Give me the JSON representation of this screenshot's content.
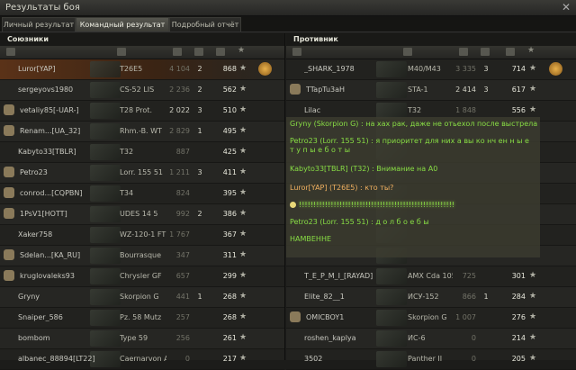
{
  "window": {
    "title": "Результаты боя"
  },
  "tabs": [
    "Личный результат",
    "Командный результат",
    "Подробный отчёт"
  ],
  "allies": {
    "title": "Союзники",
    "rows": [
      {
        "name": "Luror[YAP]",
        "tank": "T26E5",
        "damage": "4 104",
        "kills": "2",
        "xp": "868",
        "medal": true,
        "highlight": true
      },
      {
        "name": "sergeyovs1980",
        "tank": "CS-52 LIS",
        "damage": "2 236",
        "kills": "2",
        "xp": "562"
      },
      {
        "name": "vetaliy85[-UAR-]",
        "tank": "T28 Prot.",
        "damage": "2 022",
        "kills": "3",
        "xp": "510",
        "badge": true,
        "bright": true
      },
      {
        "name": "Renam...[UA_32]",
        "tank": "Rhm.-B. WT",
        "damage": "2 829",
        "kills": "1",
        "xp": "495",
        "badge": true
      },
      {
        "name": "Kabyto33[TBLR]",
        "tank": "T32",
        "damage": "887",
        "kills": "",
        "xp": "425"
      },
      {
        "name": "Petro23",
        "tank": "Lorr. 155 51",
        "damage": "1 211",
        "kills": "3",
        "xp": "411",
        "badge": true
      },
      {
        "name": "conrod...[CQPBN]",
        "tank": "T34",
        "damage": "824",
        "kills": "",
        "xp": "395",
        "badge": true
      },
      {
        "name": "1PsV1[HOTT]",
        "tank": "UDES 14 5",
        "damage": "992",
        "kills": "2",
        "xp": "386",
        "badge": true
      },
      {
        "name": "Xaker758",
        "tank": "WZ-120-1 FT",
        "damage": "1 767",
        "kills": "",
        "xp": "367"
      },
      {
        "name": "Sdelan...[KA_RU]",
        "tank": "Bourrasque",
        "damage": "347",
        "kills": "",
        "xp": "311",
        "badge": true
      },
      {
        "name": "kruglovaleks93",
        "tank": "Chrysler GF",
        "damage": "657",
        "kills": "",
        "xp": "299",
        "badge": true
      },
      {
        "name": "Gryny",
        "tank": "Skorpion G",
        "damage": "441",
        "kills": "1",
        "xp": "268"
      },
      {
        "name": "Snaiper_586",
        "tank": "Pz. 58 Mutz",
        "damage": "257",
        "kills": "",
        "xp": "268"
      },
      {
        "name": "bombom",
        "tank": "Type 59",
        "damage": "256",
        "kills": "",
        "xp": "261"
      },
      {
        "name": "albanec_88894[LT22]",
        "tank": "Caernarvon A",
        "damage": "0",
        "kills": "",
        "xp": "217"
      }
    ]
  },
  "enemies": {
    "title": "Противник",
    "rows": [
      {
        "name": "_SHARK_1978",
        "tank": "M40/M43",
        "damage": "3 335",
        "kills": "3",
        "xp": "714",
        "medal": true
      },
      {
        "name": "TTapTu3aH",
        "tank": "STA-1",
        "damage": "2 414",
        "kills": "3",
        "xp": "617",
        "badge": true,
        "bright": true
      },
      {
        "name": "Lilac",
        "tank": "T32",
        "damage": "1 848",
        "kills": "",
        "xp": "556"
      },
      {
        "name": "",
        "tank": "",
        "damage": "",
        "kills": "",
        "xp": ""
      },
      {
        "name": "",
        "tank": "",
        "damage": "",
        "kills": "",
        "xp": ""
      },
      {
        "name": "",
        "tank": "",
        "damage": "",
        "kills": "",
        "xp": ""
      },
      {
        "name": "",
        "tank": "",
        "damage": "",
        "kills": "",
        "xp": ""
      },
      {
        "name": "",
        "tank": "",
        "damage": "",
        "kills": "",
        "xp": ""
      },
      {
        "name": "",
        "tank": "",
        "damage": "",
        "kills": "",
        "xp": ""
      },
      {
        "name": "",
        "tank": "",
        "damage": "",
        "kills": "",
        "xp": ""
      },
      {
        "name": "T_E_P_M_I_[RAYAD]",
        "tank": "AMX Cda 105",
        "damage": "725",
        "kills": "",
        "xp": "301"
      },
      {
        "name": "Elite_82__1",
        "tank": "ИСУ-152",
        "damage": "866",
        "kills": "1",
        "xp": "284"
      },
      {
        "name": "OMICBOY1",
        "tank": "Skorpion G",
        "damage": "1 007",
        "kills": "",
        "xp": "276",
        "badge": true
      },
      {
        "name": "roshen_kaplya",
        "tank": "ИС-6",
        "damage": "0",
        "kills": "",
        "xp": "214"
      },
      {
        "name": "3502",
        "tank": "Panther II",
        "damage": "0",
        "kills": "",
        "xp": "205"
      }
    ]
  },
  "chat": [
    {
      "text": "Gryny (Skorpion G) : на хах рак, даже не отьехол после выстрела"
    },
    {
      "text": "Petro23 (Lorr. 155 51) : я приоритет для них а вы ко нч ен н ы е"
    },
    {
      "text": "т у п ы е б о т ы"
    },
    {
      "text": "Kabyto33[TBLR] (T32) : Внимание на A0"
    },
    {
      "text": "Luror[YAP] (T26E5) : кто ты?",
      "orange": true
    },
    {
      "text": "!!!!!!!!!!!!!!!!!!!!!!!!!!!!!!!!!!!!!!!!!!!!!!!!!!!!!!",
      "emoji": true,
      "glow": true
    },
    {
      "text": "Petro23 (Lorr. 155 51) : д о л б о е б ы"
    },
    {
      "text": "HAMBEHHE"
    }
  ],
  "colors": {
    "accent": "#88dd44",
    "highlight": "#5a3218",
    "medal": "#e8b04a"
  }
}
